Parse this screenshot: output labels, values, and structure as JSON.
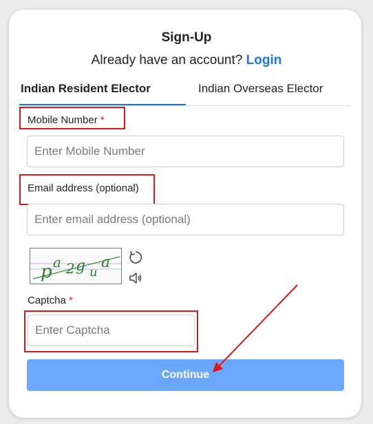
{
  "header": {
    "title": "Sign-Up",
    "login_prompt": "Already have an account?",
    "login_link": "Login"
  },
  "tabs": [
    {
      "label": "Indian Resident Elector",
      "active": true
    },
    {
      "label": "Indian Overseas Elector",
      "active": false
    }
  ],
  "form": {
    "mobile": {
      "label": "Mobile Number",
      "required_mark": "*",
      "placeholder": "Enter Mobile Number",
      "value": ""
    },
    "email": {
      "label": "Email address (optional)",
      "placeholder": "Enter email address (optional)",
      "value": ""
    },
    "captcha": {
      "image_text": "pa2gua",
      "label": "Captcha",
      "required_mark": "*",
      "placeholder": "Enter Captcha",
      "value": "",
      "refresh_icon": "refresh-icon",
      "audio_icon": "speaker-icon"
    },
    "continue_label": "Continue"
  },
  "colors": {
    "accent": "#1a73e8",
    "button": "#6aa8ff",
    "required": "#d81b1b",
    "highlight": "#e01515"
  }
}
